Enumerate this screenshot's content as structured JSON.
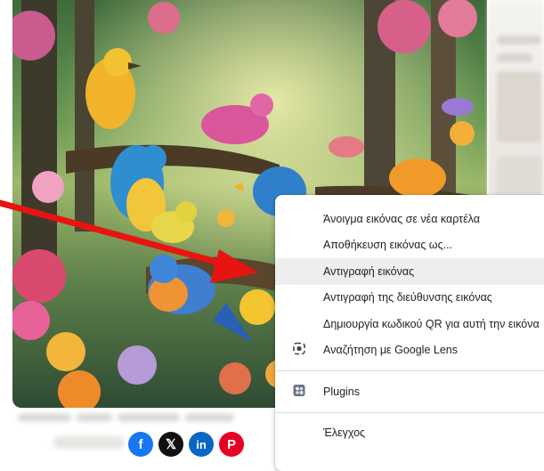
{
  "context_menu": {
    "items": [
      {
        "label": "Άνοιγμα εικόνας σε νέα καρτέλα"
      },
      {
        "label": "Αποθήκευση εικόνας ως..."
      },
      {
        "label": "Αντιγραφή εικόνας",
        "highlighted": true
      },
      {
        "label": "Αντιγραφή της διεύθυνσης εικόνας"
      },
      {
        "label": "Δημιουργία κωδικού QR για αυτή την εικόνα"
      },
      {
        "label": "Αναζήτηση με Google Lens",
        "icon": "google-lens-icon"
      },
      {
        "label": "Plugins",
        "icon": "puzzle-plugin-icon"
      },
      {
        "label": "Έλεγχος"
      }
    ]
  },
  "social": {
    "facebook": {
      "glyph": "f",
      "color": "#1877f2"
    },
    "x": {
      "glyph": "𝕏",
      "color": "#111111"
    },
    "linkedin": {
      "glyph": "in",
      "color": "#0a66c2"
    },
    "pinterest": {
      "glyph": "P",
      "color": "#e60023"
    }
  },
  "annotation": {
    "color": "#e8140f",
    "icon": "red-arrow"
  }
}
